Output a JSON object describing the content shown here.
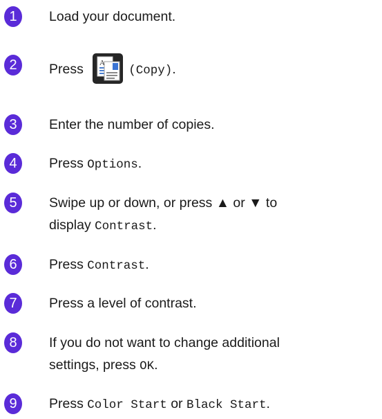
{
  "colors": {
    "step_number": "#5a2bd8",
    "icon_bg": "#262626"
  },
  "icons": {
    "copy": "copy-icon"
  },
  "steps": [
    {
      "number": "1",
      "parts": [
        "Load your document."
      ]
    },
    {
      "number": "2",
      "parts": [
        "Press",
        "(Copy)",
        "."
      ]
    },
    {
      "number": "3",
      "parts": [
        "Enter the number of copies."
      ]
    },
    {
      "number": "4",
      "parts": [
        "Press ",
        "Options",
        "."
      ]
    },
    {
      "number": "5",
      "parts": [
        "Swipe up or down, or press ▲ or ▼ to",
        "display ",
        "Contrast",
        "."
      ]
    },
    {
      "number": "6",
      "parts": [
        "Press ",
        "Contrast",
        "."
      ]
    },
    {
      "number": "7",
      "parts": [
        "Press a level of contrast."
      ]
    },
    {
      "number": "8",
      "parts": [
        "If you do not want to change additional",
        "settings, press ",
        "OK",
        "."
      ]
    },
    {
      "number": "9",
      "parts": [
        "Press ",
        "Color Start",
        " or ",
        "Black Start",
        "."
      ]
    }
  ]
}
